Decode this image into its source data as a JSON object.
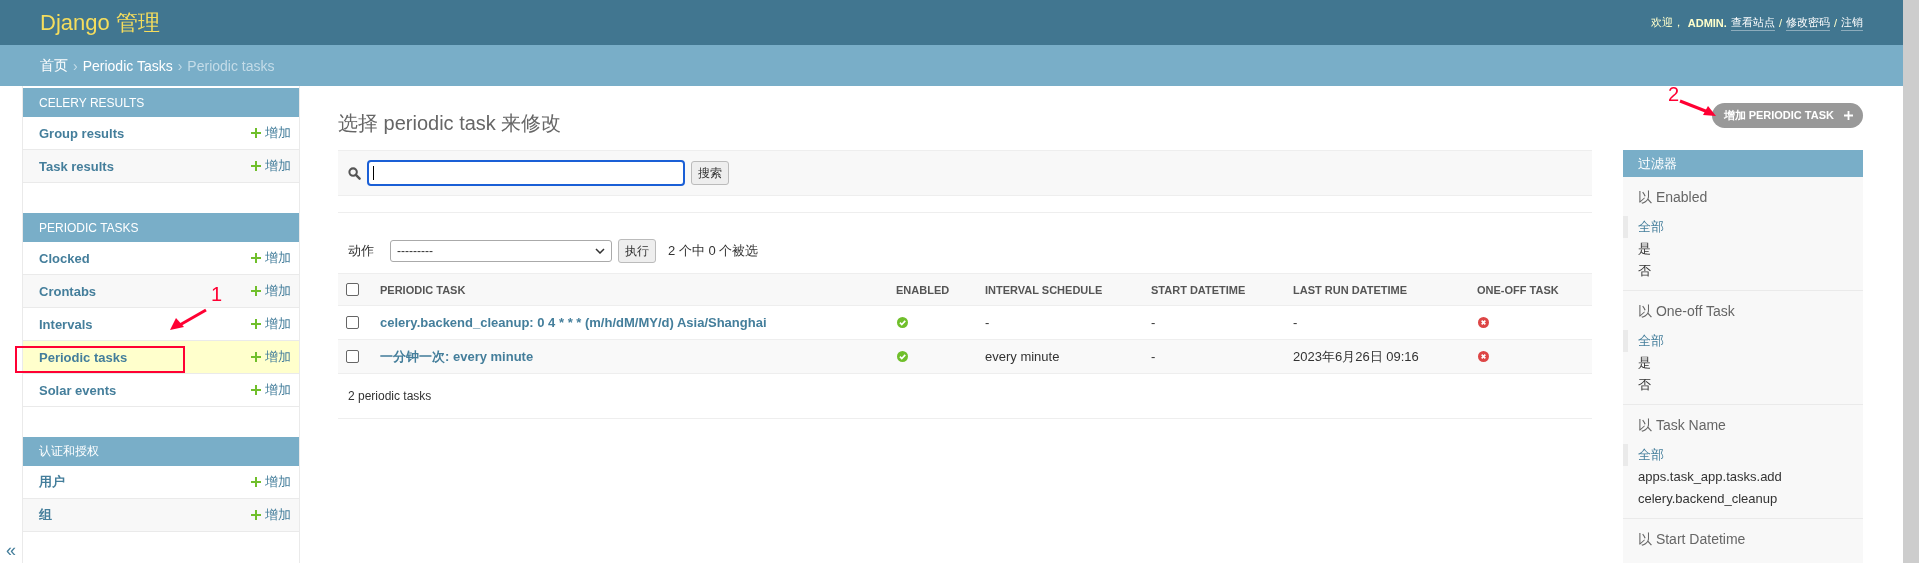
{
  "header": {
    "title": "Django 管理",
    "welcome": "欢迎，",
    "user": "ADMIN.",
    "separator": "/",
    "links": [
      "查看站点",
      "修改密码",
      "注销"
    ]
  },
  "breadcrumbs": {
    "separator": "›",
    "items": [
      {
        "label": "首页",
        "current": false
      },
      {
        "label": "Periodic Tasks",
        "current": false
      },
      {
        "label": "Periodic tasks",
        "current": true
      }
    ]
  },
  "sidebar": {
    "toggle": "«",
    "sections": [
      {
        "title": "CELERY RESULTS",
        "items": [
          {
            "name": "Group results",
            "add": "增加",
            "selected": false
          },
          {
            "name": "Task results",
            "add": "增加",
            "selected": false
          }
        ]
      },
      {
        "title": "PERIODIC TASKS",
        "items": [
          {
            "name": "Clocked",
            "add": "增加",
            "selected": false
          },
          {
            "name": "Crontabs",
            "add": "增加",
            "selected": false
          },
          {
            "name": "Intervals",
            "add": "增加",
            "selected": false
          },
          {
            "name": "Periodic tasks",
            "add": "增加",
            "selected": true
          },
          {
            "name": "Solar events",
            "add": "增加",
            "selected": false
          }
        ]
      },
      {
        "title": "认证和授权",
        "items": [
          {
            "name": "用户",
            "add": "增加",
            "selected": false
          },
          {
            "name": "组",
            "add": "增加",
            "selected": false
          }
        ]
      }
    ]
  },
  "page_title": "选择 periodic task 来修改",
  "add_button": "增加 PERIODIC TASK",
  "search": {
    "button": "搜索"
  },
  "actions": {
    "label": "动作",
    "value": "---------",
    "button": "执行",
    "count": "2 个中 0 个被选"
  },
  "table": {
    "select_all": {
      "checked": false
    },
    "columns": [
      "PERIODIC TASK",
      "ENABLED",
      "INTERVAL SCHEDULE",
      "START DATETIME",
      "LAST RUN DATETIME",
      "ONE-OFF TASK"
    ],
    "rows": [
      {
        "checked": false,
        "task": "celery.backend_cleanup: 0 4 * * * (m/h/dM/MY/d) Asia/Shanghai",
        "enabled": true,
        "interval": "-",
        "start": "-",
        "last_run": "-",
        "one_off": false
      },
      {
        "checked": false,
        "task": "一分钟一次: every minute",
        "enabled": true,
        "interval": "every minute",
        "start": "-",
        "last_run": "2023年6月26日 09:16",
        "one_off": false
      }
    ]
  },
  "result_count": "2 periodic tasks",
  "filter": {
    "title": "过滤器",
    "groups": [
      {
        "title": "以 Enabled",
        "options": [
          {
            "label": "全部",
            "selected": true
          },
          {
            "label": "是",
            "selected": false
          },
          {
            "label": "否",
            "selected": false
          }
        ]
      },
      {
        "title": "以 One-off Task",
        "options": [
          {
            "label": "全部",
            "selected": true
          },
          {
            "label": "是",
            "selected": false
          },
          {
            "label": "否",
            "selected": false
          }
        ]
      },
      {
        "title": "以 Task Name",
        "options": [
          {
            "label": "全部",
            "selected": true
          },
          {
            "label": "apps.task_app.tasks.add",
            "selected": false
          },
          {
            "label": "celery.backend_cleanup",
            "selected": false
          }
        ]
      },
      {
        "title": "以 Start Datetime"
      }
    ]
  },
  "annotations": [
    {
      "kind": "box"
    },
    {
      "kind": "arrow",
      "label": "1"
    },
    {
      "kind": "arrow",
      "label": "2"
    }
  ]
}
